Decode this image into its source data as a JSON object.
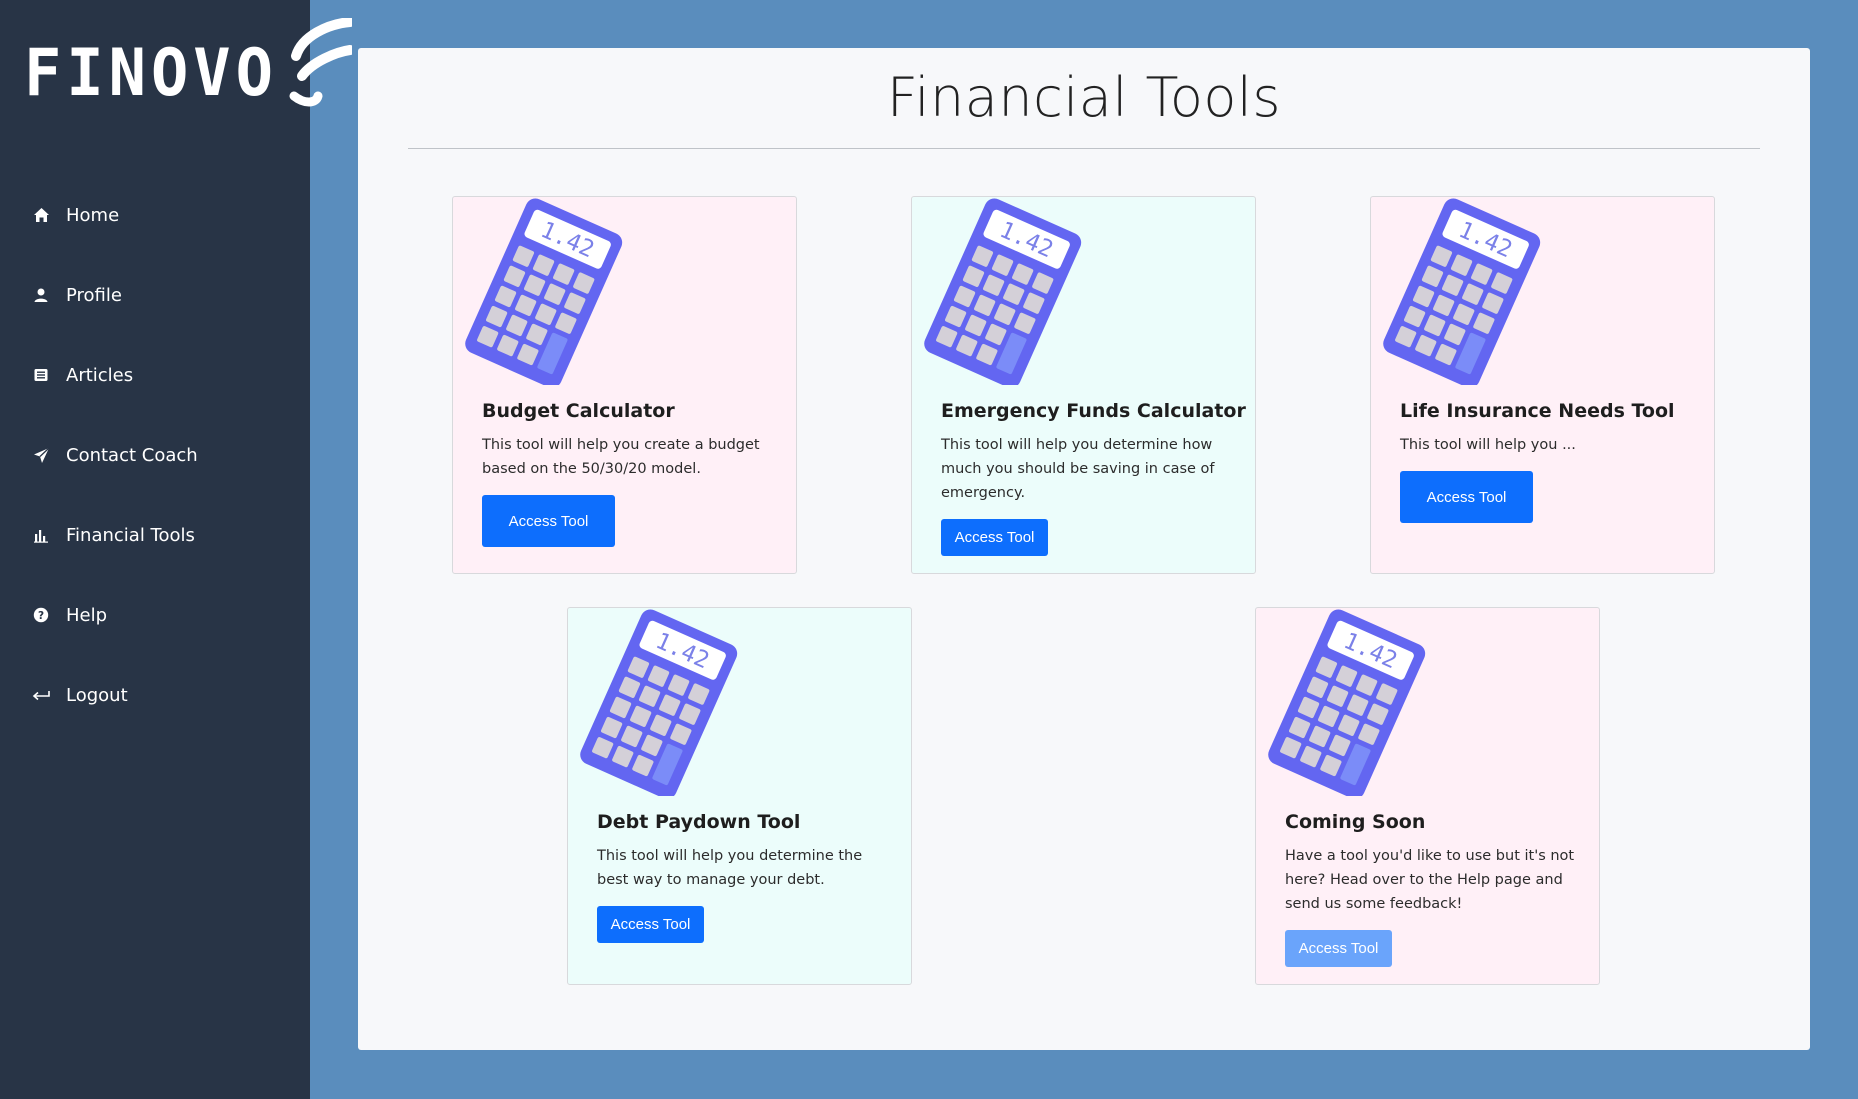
{
  "brand": {
    "name": "FINOVO"
  },
  "nav": {
    "items": [
      {
        "label": "Home",
        "icon": "home-icon"
      },
      {
        "label": "Profile",
        "icon": "user-icon"
      },
      {
        "label": "Articles",
        "icon": "newspaper-icon"
      },
      {
        "label": "Contact Coach",
        "icon": "paper-plane-icon"
      },
      {
        "label": "Financial Tools",
        "icon": "bar-chart-icon"
      },
      {
        "label": "Help",
        "icon": "question-circle-icon"
      },
      {
        "label": "Logout",
        "icon": "logout-arrow-icon"
      }
    ]
  },
  "page": {
    "title": "Financial Tools"
  },
  "cards": [
    {
      "title": "Budget Calculator",
      "description": "This tool will help you create a budget based on the 50/30/20 model.",
      "button": "Access Tool",
      "calc_display": "1.42",
      "color": "#fff0f7"
    },
    {
      "title": "Emergency Funds Calculator",
      "description": "This tool will help you determine how much you should be saving in case of emergency.",
      "button": "Access Tool",
      "calc_display": "1.42",
      "color": "#ecfdfb"
    },
    {
      "title": "Life Insurance Needs Tool",
      "description": "This tool will help you ...",
      "button": "Access Tool",
      "calc_display": "1.42",
      "color": "#fff0f7"
    },
    {
      "title": "Debt Paydown Tool",
      "description": "This tool will help you determine the best way to manage your debt.",
      "button": "Access Tool",
      "calc_display": "1.42",
      "color": "#ecfdfb"
    },
    {
      "title": "Coming Soon",
      "description": "Have a tool you'd like to use but it's not here? Head over to the Help page and send us some feedback!",
      "button": "Access Tool",
      "calc_display": "1.42",
      "color": "#fff0f7",
      "disabled": true
    }
  ],
  "colors": {
    "sidebar": "#283446",
    "background": "#5a8dbd",
    "primary": "#0d6efd",
    "calculator": "#6366f1"
  }
}
